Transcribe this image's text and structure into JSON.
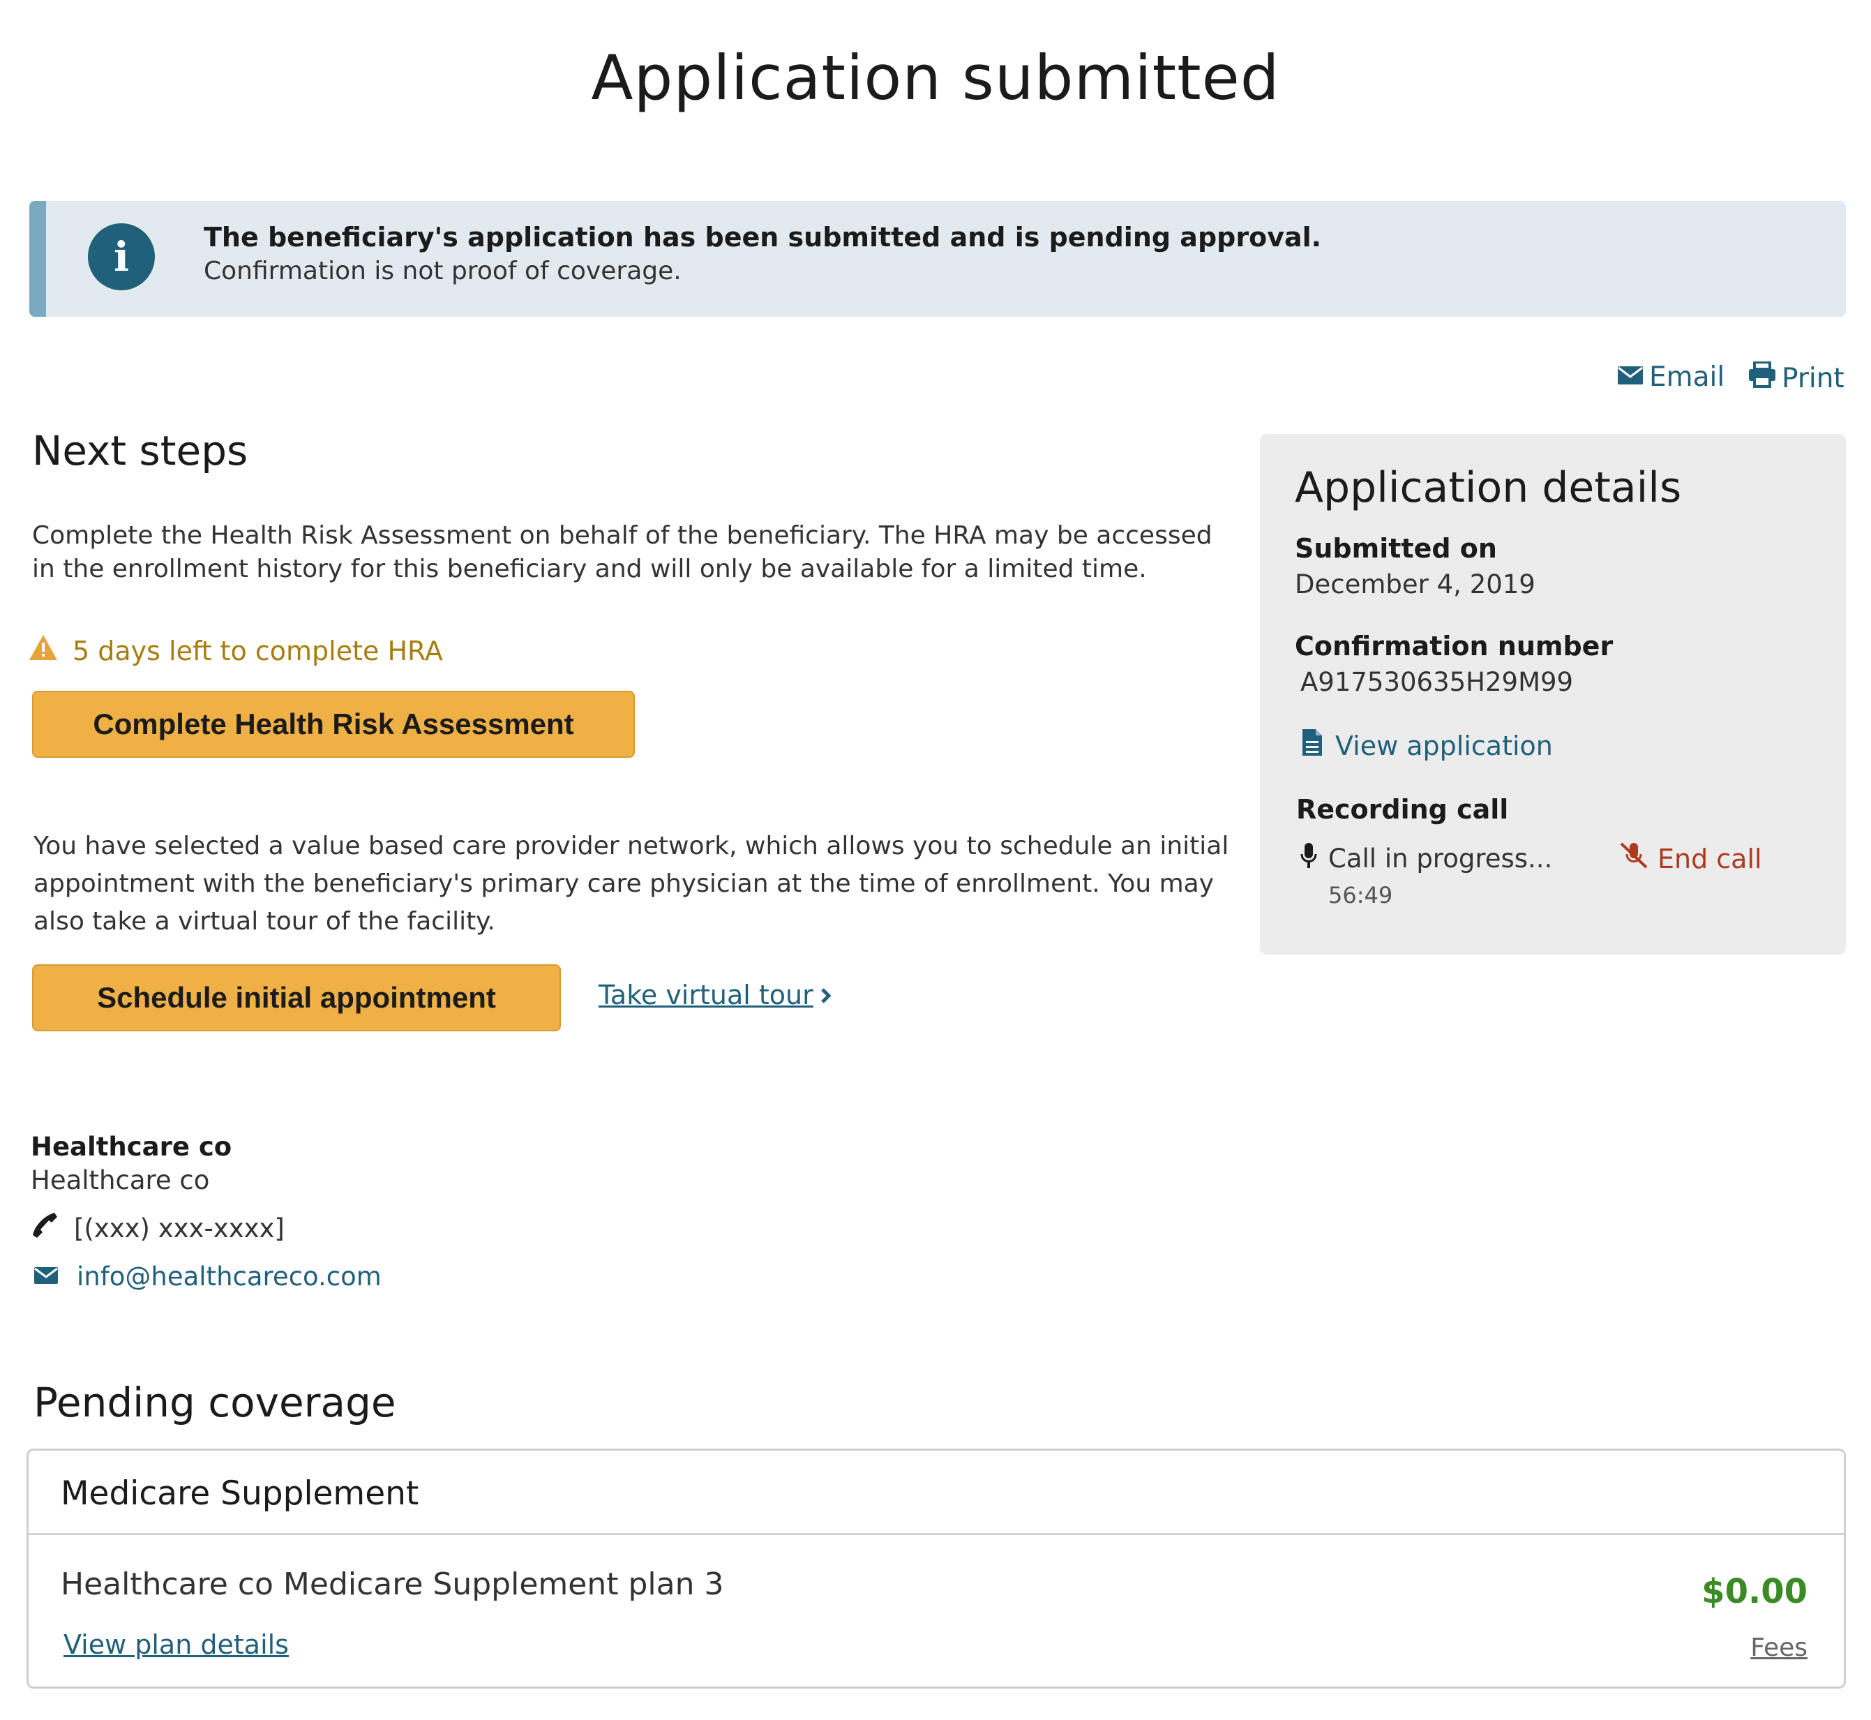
{
  "page": {
    "title": "Application submitted"
  },
  "alert": {
    "icon": "info-icon",
    "title": "The beneficiary's application has been submitted and is pending approval.",
    "subtitle": "Confirmation is not proof of coverage."
  },
  "actions": {
    "email_label": "Email",
    "print_label": "Print"
  },
  "next_steps": {
    "heading": "Next steps",
    "hra_text": "Complete the Health Risk Assessment on behalf of the beneficiary.  The HRA may be accessed in the enrollment history for this beneficiary and will only be available for a limited time.",
    "warning_text": "5 days left to complete HRA",
    "hra_button": "Complete Health Risk Assessment",
    "network_text": "You have selected a value based care provider network, which allows you to schedule an initial appointment with the beneficiary's primary care physician at the time of enrollment. You may also take a virtual tour of the facility.",
    "schedule_button": "Schedule initial appointment",
    "tour_link": "Take virtual tour"
  },
  "contact": {
    "name_bold": "Healthcare co",
    "name": "Healthcare co",
    "phone": "[(xxx) xxx-xxxx]",
    "email": "info@healthcareco.com"
  },
  "details": {
    "heading": "Application details",
    "submitted_label": "Submitted on",
    "submitted_value": "December 4, 2019",
    "confirmation_label": "Confirmation number",
    "confirmation_value": "A917530635H29M99",
    "view_application": "View application",
    "recording_label": "Recording call",
    "call_status": "Call in progress...",
    "call_timer": "56:49",
    "end_call": "End call"
  },
  "coverage": {
    "heading": "Pending coverage",
    "card_title": "Medicare Supplement",
    "plan_name": "Healthcare co Medicare Supplement plan 3",
    "price": "$0.00",
    "view_plan_link": "View plan details",
    "fees_link": "Fees"
  },
  "colors": {
    "accent": "#21607a",
    "button": "#efb046",
    "warning": "#a87d10",
    "danger": "#b0391f",
    "price": "#3a8a26",
    "alert_bg": "#e2e9ef",
    "alert_border": "#79aabf"
  },
  "icons": [
    "info-icon",
    "envelope-icon",
    "printer-icon",
    "warning-icon",
    "chevron-right-icon",
    "document-icon",
    "microphone-icon",
    "mic-off-icon",
    "phone-icon"
  ]
}
